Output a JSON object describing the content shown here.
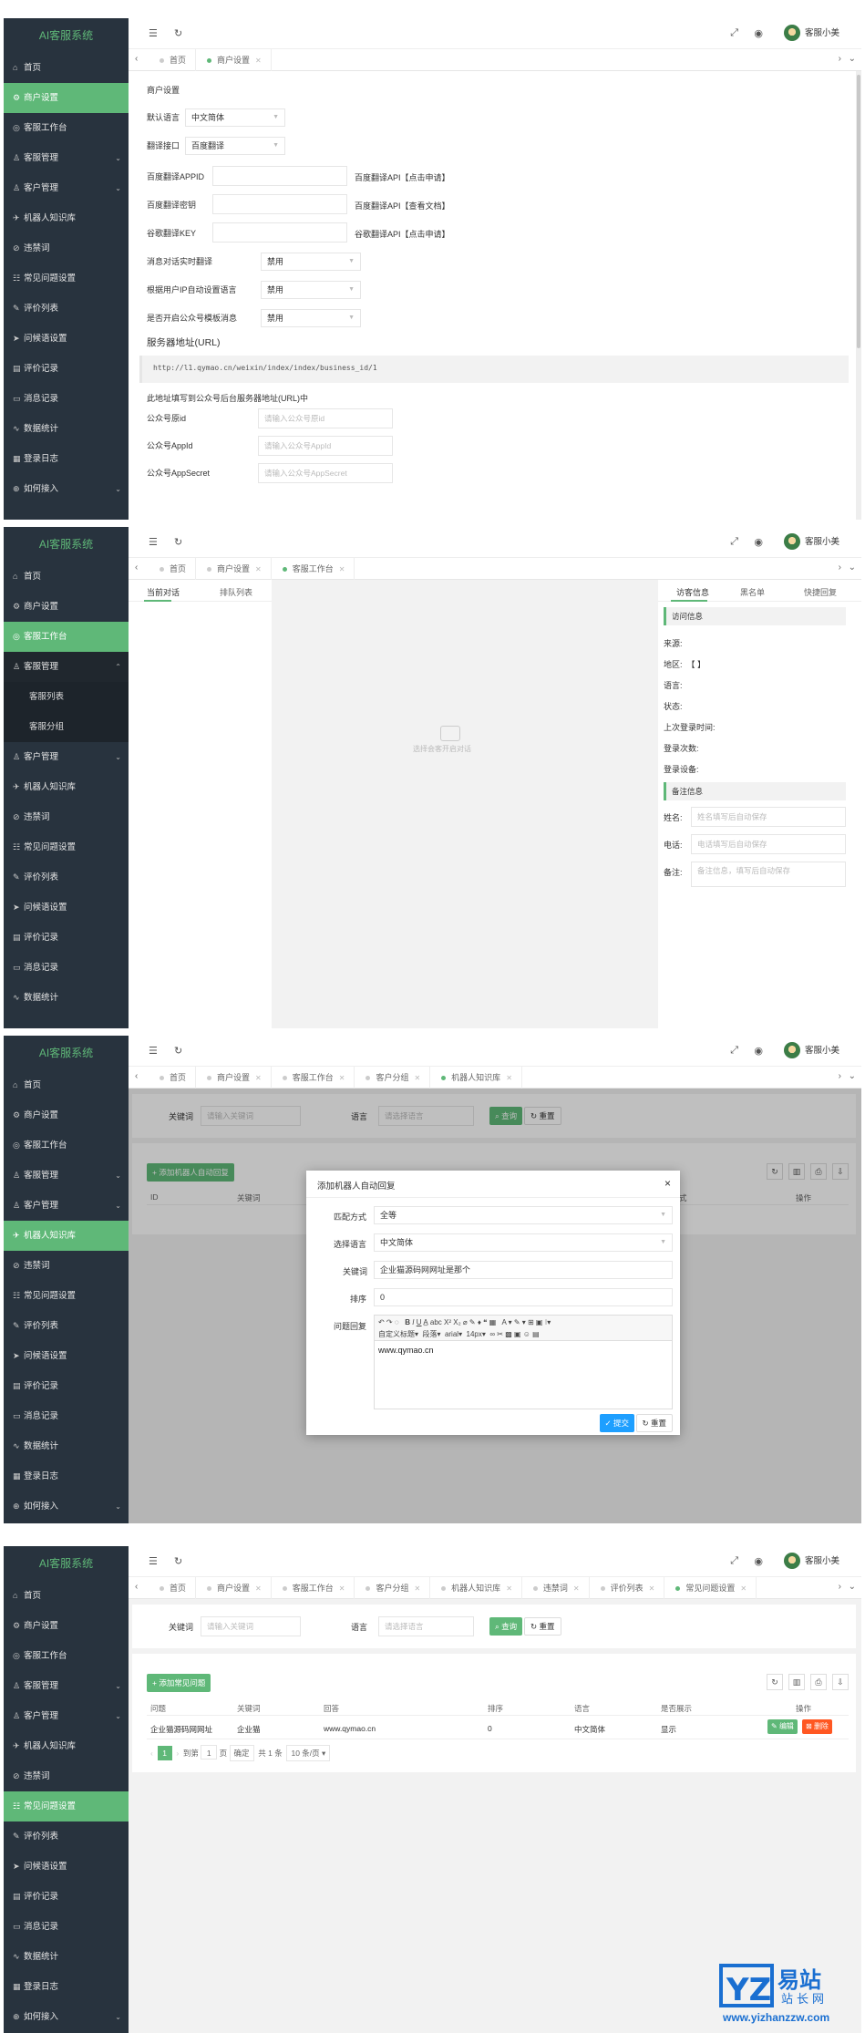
{
  "app": {
    "logo": "AI客服系统",
    "user_name": "客服小美",
    "accent": "#5fb878",
    "sidebar_bg": "#28333e"
  },
  "menu_labels": {
    "home": "首页",
    "merchant": "商户设置",
    "workbench": "客服工作台",
    "staff": "客服管理",
    "staff_list": "客服列表",
    "staff_group": "客服分组",
    "customer": "客户管理",
    "knowledge": "机器人知识库",
    "banned": "违禁词",
    "faq": "常见问题设置",
    "review": "评价列表",
    "greeting": "问候语设置",
    "eval_record": "评价记录",
    "msg_record": "消息记录",
    "stats": "数据统计",
    "login_log": "登录日志",
    "access": "如何接入"
  },
  "tab_labels": {
    "home": "首页",
    "merchant": "商户设置",
    "workbench": "客服工作台",
    "customer_group": "客户分组",
    "knowledge": "机器人知识库",
    "banned": "违禁词",
    "review": "评价列表",
    "faq": "常见问题设置"
  },
  "settings": {
    "section_title": "商户设置",
    "default_lang_label": "默认语言",
    "default_lang_value": "中文简体",
    "translate_label": "翻译接口",
    "translate_value": "百度翻译",
    "baidu_appid_label": "百度翻译APPID",
    "baidu_appid_hint": "百度翻译API【点击申请】",
    "baidu_key_label": "百度翻译密钥",
    "baidu_key_hint": "百度翻译API【查看文档】",
    "google_key_label": "谷歌翻译KEY",
    "google_key_hint": "谷歌翻译API【点击申请】",
    "realtime_label": "消息对话实时翻译",
    "realtime_value": "禁用",
    "ip_lang_label": "根据用户IP自动设置语言",
    "ip_lang_value": "禁用",
    "template_label": "是否开启公众号模板消息",
    "template_value": "禁用",
    "server_url_label": "服务器地址(URL)",
    "server_url_value": "http://l1.qymao.cn/weixin/index/index/business_id/1",
    "server_url_note": "此地址填写到公众号后台服务器地址(URL)中",
    "wx_origin_label": "公众号原id",
    "wx_origin_ph": "请输入公众号原id",
    "wx_appid_label": "公众号AppId",
    "wx_appid_ph": "请输入公众号AppId",
    "wx_secret_label": "公众号AppSecret",
    "wx_secret_ph": "请输入公众号AppSecret"
  },
  "workbench": {
    "tab_current": "当前对话",
    "tab_queue": "排队列表",
    "empty_text": "选择会客开启对话",
    "info_tab_visitor": "访客信息",
    "info_tab_blacklist": "黑名单",
    "info_tab_quick": "快捷回复",
    "visit_title": "访问信息",
    "source": "来源:",
    "region": "地区:",
    "region_value": "【 】",
    "language": "语言:",
    "status": "状态:",
    "last_login": "上次登录时间:",
    "login_count": "登录次数:",
    "login_device": "登录设备:",
    "note_title": "备注信息",
    "name_label": "姓名:",
    "name_ph": "姓名填写后自动保存",
    "phone_label": "电话:",
    "phone_ph": "电话填写后自动保存",
    "remark_label": "备注:",
    "remark_ph": "备注信息，填写后自动保存"
  },
  "knowledge": {
    "keyword_label": "关键词",
    "keyword_ph": "请输入关键词",
    "lang_label": "语言",
    "lang_ph": "请选择语言",
    "search_btn": "查询",
    "reset_btn": "重置",
    "add_btn": "添加机器人自动回复",
    "col_id": "ID",
    "col_keyword": "关键词",
    "col_x": "式",
    "col_op": "操作",
    "modal": {
      "title": "添加机器人自动回复",
      "match_label": "匹配方式",
      "match_value": "全等",
      "lang_label": "选择语言",
      "lang_value": "中文简体",
      "kw_label": "关键词",
      "kw_value": "企业猫源码网网址是那个",
      "sort_label": "排序",
      "sort_value": "0",
      "answer_label": "问题回复",
      "answer_value": "www.qymao.cn",
      "ed_paragraph": "自定义标题",
      "ed_para2": "段落",
      "ed_font": "arial",
      "ed_size": "14px",
      "submit": "提交",
      "reset": "重置"
    }
  },
  "faq": {
    "keyword_label": "关键词",
    "keyword_ph": "请输入关键词",
    "lang_label": "语言",
    "lang_ph": "请选择语言",
    "search_btn": "查询",
    "reset_btn": "重置",
    "add_btn": "添加常见问题",
    "columns": [
      "问题",
      "关键词",
      "回答",
      "排序",
      "语言",
      "是否展示",
      "操作"
    ],
    "row": {
      "question": "企业猫源码网网址",
      "keyword": "企业猫",
      "answer": "www.qymao.cn",
      "sort": "0",
      "lang": "中文简体",
      "show": "显示",
      "edit": "编辑",
      "delete": "删除"
    },
    "pager": {
      "page": "1",
      "goto": "到第",
      "goto_page": "1",
      "page_unit": "页",
      "confirm": "确定",
      "total": "共 1 条",
      "per_page": "10 条/页"
    }
  },
  "watermark": {
    "brand": "易站",
    "brand2": "站长网",
    "url": "www.yizhanzzw.com"
  }
}
